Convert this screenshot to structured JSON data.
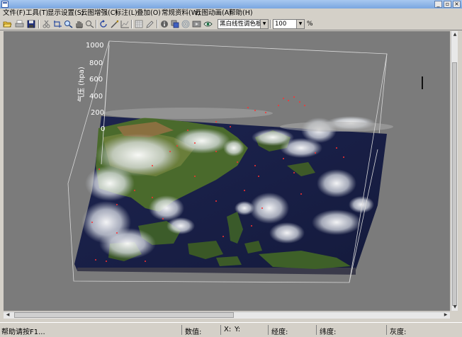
{
  "window": {
    "minimize_label": "_",
    "restore_label": "▫",
    "close_label": "×"
  },
  "menu": {
    "items": [
      {
        "label": "文件(F)"
      },
      {
        "label": "工具(T)"
      },
      {
        "label": "显示设置(S)"
      },
      {
        "label": "云图增强(C)"
      },
      {
        "label": "标注(L)"
      },
      {
        "label": "叠加(O)"
      },
      {
        "label": "常规资料(W)"
      },
      {
        "label": "云图动画(A)"
      },
      {
        "label": "帮助(H)"
      }
    ]
  },
  "toolbar": {
    "palette_value": "黑白线性调色板",
    "zoom_value": "100",
    "zoom_unit": "%"
  },
  "view3d": {
    "axis_title": "气压 (hpa)",
    "ticks": [
      "1000",
      "800",
      "600",
      "400",
      "200",
      "0"
    ]
  },
  "status": {
    "help": "帮助请按F1...",
    "value_label": "数值:",
    "x_label": "X:",
    "y_label": "Y:",
    "lon_label": "经度:",
    "lat_label": "纬度:",
    "gray_label": "灰度:"
  }
}
